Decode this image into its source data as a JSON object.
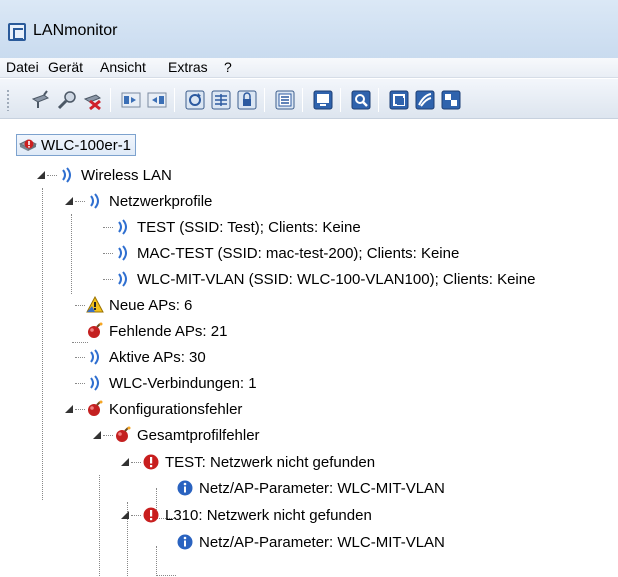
{
  "window": {
    "title": "LANmonitor"
  },
  "menu": [
    "Datei",
    "Gerät",
    "Ansicht",
    "Extras",
    "?"
  ],
  "toolbar": {
    "buttons": [
      "connect-device-icon",
      "search-device-icon",
      "remove-device-icon",
      "collapse-icon",
      "expand-icon",
      "refresh-icon",
      "table-icon",
      "lock-icon",
      "list-icon",
      "monitor-icon",
      "find-icon",
      "device-a-icon",
      "device-b-icon",
      "device-c-icon"
    ]
  },
  "tree": {
    "root": "WLC-100er-1",
    "nodes": [
      {
        "label": "Wireless LAN",
        "icon": "wireless-icon"
      },
      {
        "label": "Netzwerkprofile",
        "icon": "wireless-icon"
      },
      {
        "label": "TEST (SSID: Test); Clients: Keine",
        "icon": "wireless-icon"
      },
      {
        "label": "MAC-TEST (SSID: mac-test-200); Clients: Keine",
        "icon": "wireless-icon"
      },
      {
        "label": "WLC-MIT-VLAN (SSID: WLC-100-VLAN100); Clients: Keine",
        "icon": "wireless-icon"
      },
      {
        "label": "Neue APs: 6",
        "icon": "warning-icon"
      },
      {
        "label": "Fehlende APs: 21",
        "icon": "bomb-icon"
      },
      {
        "label": "Aktive APs: 30",
        "icon": "wireless-icon"
      },
      {
        "label": "WLC-Verbindungen: 1",
        "icon": "wireless-icon"
      },
      {
        "label": "Konfigurationsfehler",
        "icon": "bomb-icon"
      },
      {
        "label": "Gesamtprofilfehler",
        "icon": "bomb-icon"
      },
      {
        "label": "TEST: Netzwerk nicht gefunden",
        "icon": "error-icon"
      },
      {
        "label": "Netz/AP-Parameter: WLC-MIT-VLAN",
        "icon": "info-icon"
      },
      {
        "label": "L310: Netzwerk nicht gefunden",
        "icon": "error-icon"
      },
      {
        "label": "Netz/AP-Parameter: WLC-MIT-VLAN",
        "icon": "info-icon"
      }
    ]
  }
}
